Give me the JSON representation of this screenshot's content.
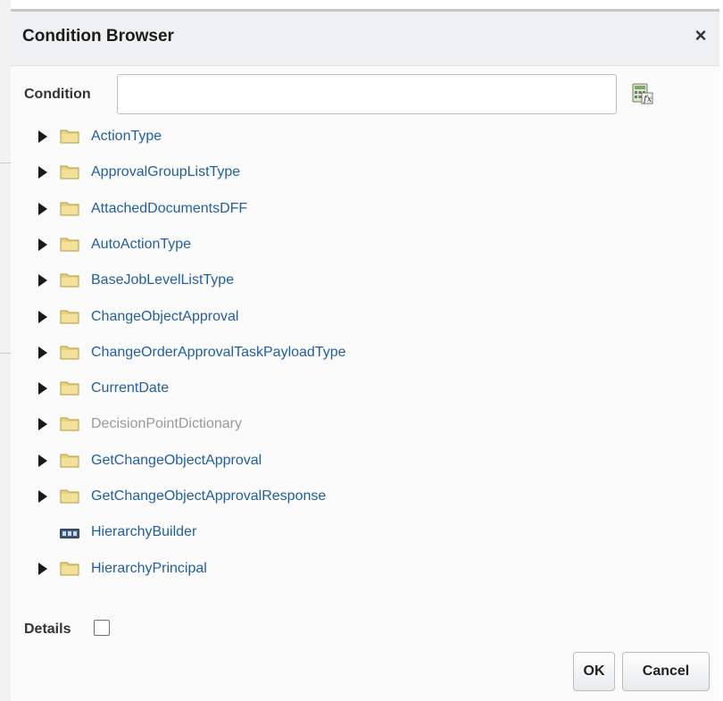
{
  "dialog": {
    "title": "Condition Browser",
    "close_label": "×"
  },
  "condition": {
    "label": "Condition",
    "value": "",
    "placeholder": ""
  },
  "tree": {
    "items": [
      {
        "label": "ActionType",
        "icon": "folder-icon",
        "expandable": true,
        "disabled": false
      },
      {
        "label": "ApprovalGroupListType",
        "icon": "folder-icon",
        "expandable": true,
        "disabled": false
      },
      {
        "label": "AttachedDocumentsDFF",
        "icon": "folder-icon",
        "expandable": true,
        "disabled": false
      },
      {
        "label": "AutoActionType",
        "icon": "folder-icon",
        "expandable": true,
        "disabled": false
      },
      {
        "label": "BaseJobLevelListType",
        "icon": "folder-icon",
        "expandable": true,
        "disabled": false
      },
      {
        "label": "ChangeObjectApproval",
        "icon": "folder-icon",
        "expandable": true,
        "disabled": false
      },
      {
        "label": "ChangeOrderApprovalTaskPayloadType",
        "icon": "folder-icon",
        "expandable": true,
        "disabled": false
      },
      {
        "label": "CurrentDate",
        "icon": "folder-icon",
        "expandable": true,
        "disabled": false
      },
      {
        "label": "DecisionPointDictionary",
        "icon": "folder-icon",
        "expandable": true,
        "disabled": true
      },
      {
        "label": "GetChangeObjectApproval",
        "icon": "folder-icon",
        "expandable": true,
        "disabled": false
      },
      {
        "label": "GetChangeObjectApprovalResponse",
        "icon": "folder-icon",
        "expandable": true,
        "disabled": false
      },
      {
        "label": "HierarchyBuilder",
        "icon": "variable-icon",
        "expandable": false,
        "disabled": false
      },
      {
        "label": "HierarchyPrincipal",
        "icon": "folder-icon",
        "expandable": true,
        "disabled": false
      }
    ]
  },
  "details": {
    "label": "Details",
    "checked": false
  },
  "buttons": {
    "ok": "OK",
    "cancel": "Cancel"
  },
  "colors": {
    "link": "#1f5f9f",
    "disabled": "#9a9a9a",
    "folder": "#e8d27a"
  }
}
